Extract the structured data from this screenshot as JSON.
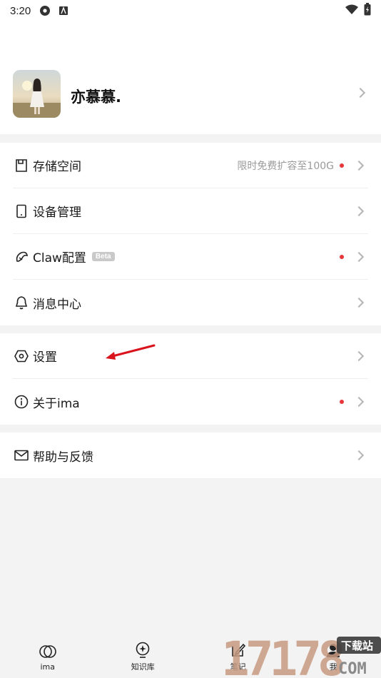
{
  "status_bar": {
    "time": "3:20",
    "left_icons": [
      "settings-gear-icon",
      "a-badge-icon"
    ],
    "right_icons": [
      "wifi-icon",
      "battery-icon"
    ]
  },
  "profile": {
    "username": "亦慕慕."
  },
  "menu_group_1": [
    {
      "icon": "storage-icon",
      "label": "存储空间",
      "hint": "限时免费扩容至100G",
      "dot": true
    },
    {
      "icon": "tablet-icon",
      "label": "设备管理",
      "hint": "",
      "dot": false
    },
    {
      "icon": "claw-icon",
      "label": "Claw配置",
      "badge": "Beta",
      "dot": true
    },
    {
      "icon": "bell-icon",
      "label": "消息中心",
      "hint": "",
      "dot": false
    }
  ],
  "menu_group_2": [
    {
      "icon": "hexagon-settings-icon",
      "label": "设置",
      "dot": false
    },
    {
      "icon": "info-icon",
      "label": "关于ima",
      "dot": true
    }
  ],
  "menu_group_3": [
    {
      "icon": "mail-icon",
      "label": "帮助与反馈",
      "dot": false
    }
  ],
  "tabbar": [
    {
      "icon": "ima-icon",
      "label": "ima"
    },
    {
      "icon": "lightbulb-icon",
      "label": "知识库"
    },
    {
      "icon": "note-edit-icon",
      "label": "笔记"
    },
    {
      "icon": "person-icon",
      "label": "我"
    }
  ],
  "watermark": {
    "text": "17178",
    "sub": "下载站",
    "domain": "COM"
  },
  "colors": {
    "red_dot": "#e8363b",
    "annotation_arrow": "#d9141c",
    "background": "#f3f3f3"
  }
}
